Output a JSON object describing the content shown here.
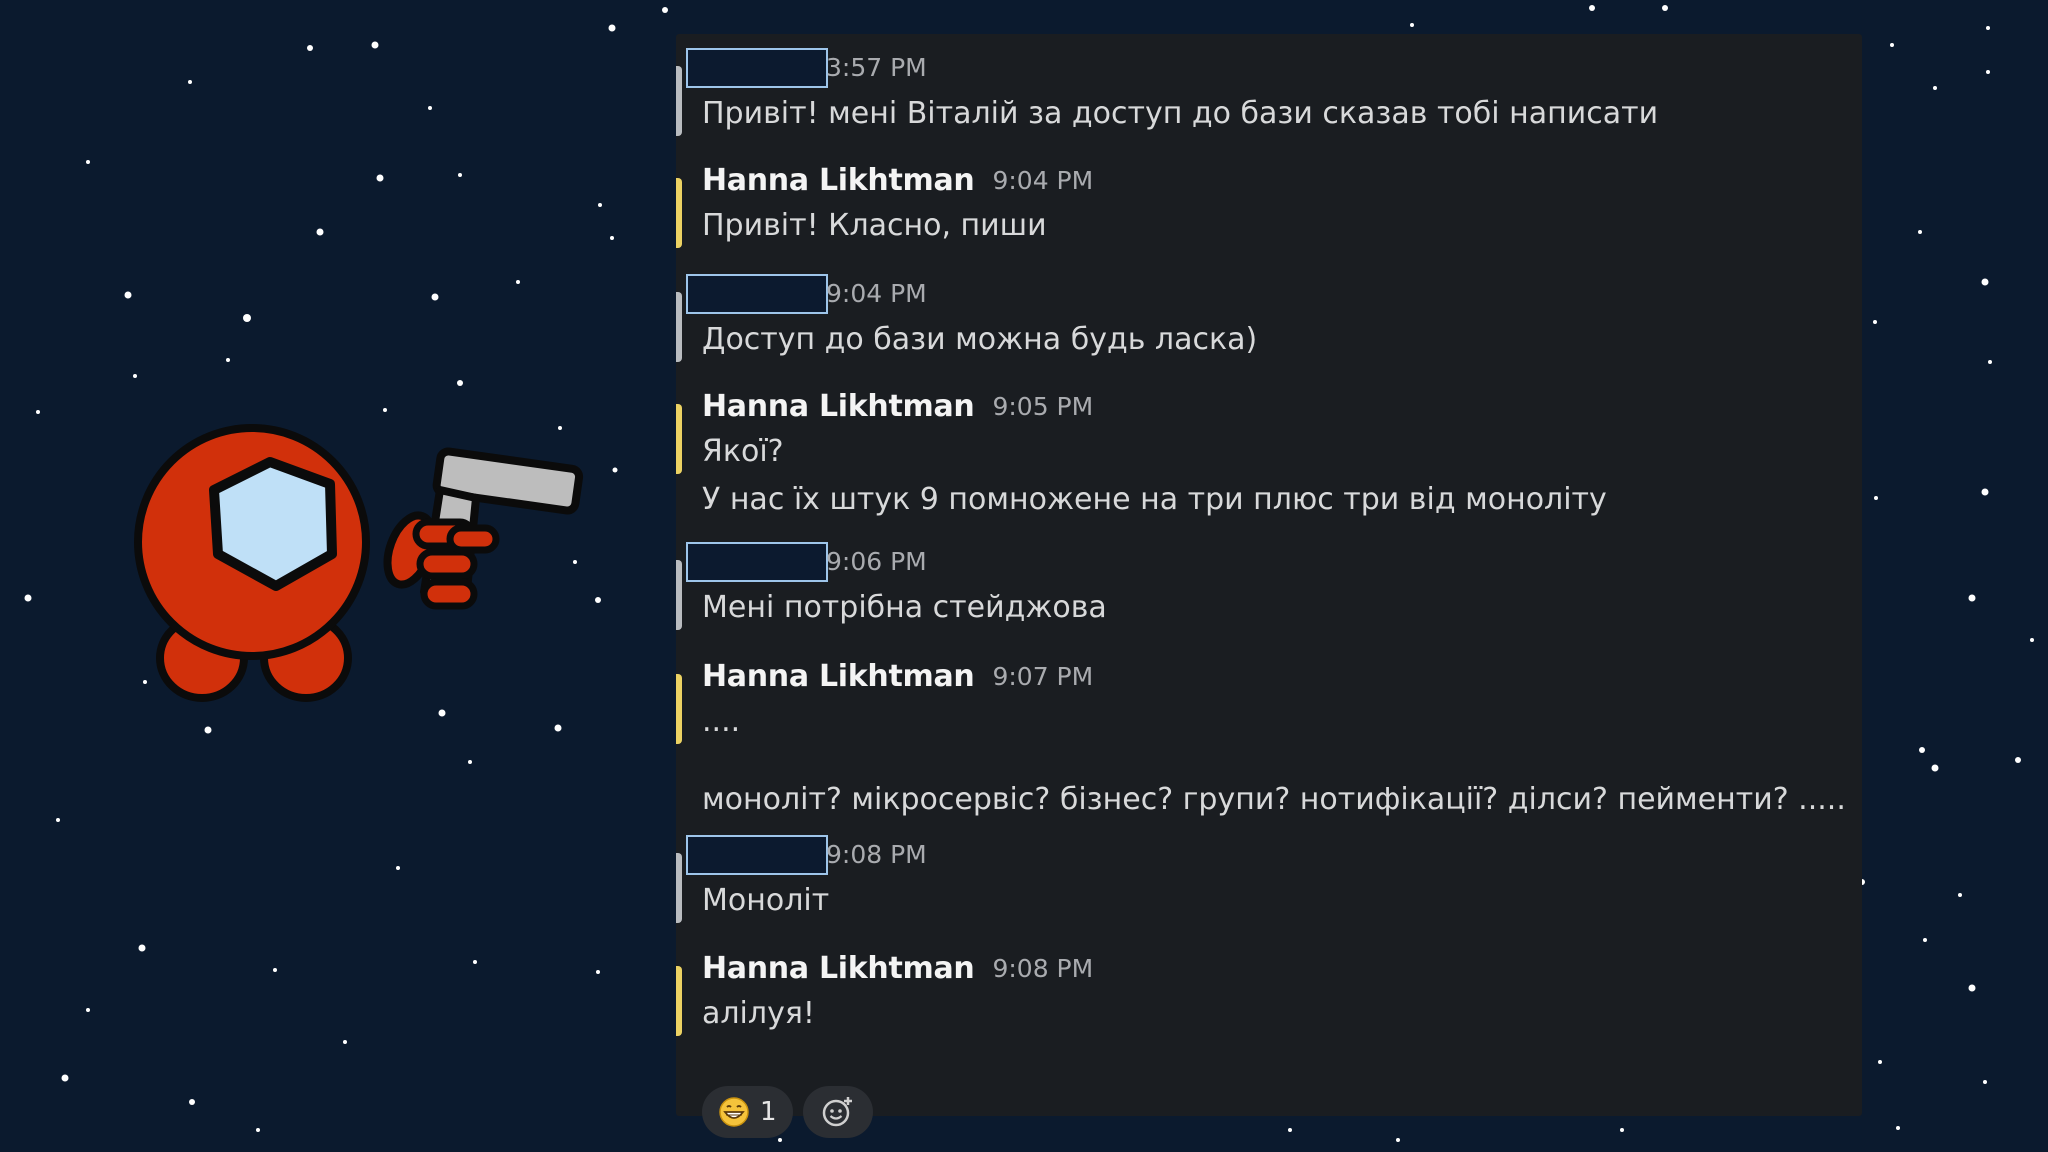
{
  "messages": [
    {
      "author": "",
      "time": "3:57 PM",
      "lines": [
        "Привіт! мені Віталій за доступ до бази сказав тобі написати"
      ]
    },
    {
      "author": "Hanna Likhtman",
      "time": "9:04 PM",
      "lines": [
        "Привіт! Класно, пиши"
      ]
    },
    {
      "author": "",
      "time": "9:04 PM",
      "lines": [
        "Доступ до бази можна будь ласка)"
      ]
    },
    {
      "author": "Hanna Likhtman",
      "time": "9:05 PM",
      "lines": [
        "Якої?",
        "У нас їх штук 9 помножене на три плюс три від моноліту"
      ]
    },
    {
      "author": "",
      "time": "9:06 PM",
      "lines": [
        "Мені потрібна стейджова"
      ]
    },
    {
      "author": "Hanna Likhtman",
      "time": "9:07 PM",
      "lines": [
        "....",
        "моноліт? мікросервіс? бізнес? групи? нотифікації? ділси? пейменти? ....."
      ]
    },
    {
      "author": "",
      "time": "9:08 PM",
      "lines": [
        "Моноліт"
      ]
    },
    {
      "author": "Hanna Likhtman",
      "time": "9:08 PM",
      "lines": [
        "алілуя!"
      ]
    }
  ],
  "reactions": [
    {
      "emoji": "😁",
      "icon": "grinning-face-icon",
      "count": "1"
    }
  ],
  "add_reaction_icon": "add-reaction-icon",
  "colors": {
    "background": "#0b1a2e",
    "panel": "#1a1d21",
    "hanna_bar": "#ecd263",
    "other_bar": "#b9bcc0",
    "crewmate_red": "#d1300b",
    "visor": "#bfe0f7"
  }
}
